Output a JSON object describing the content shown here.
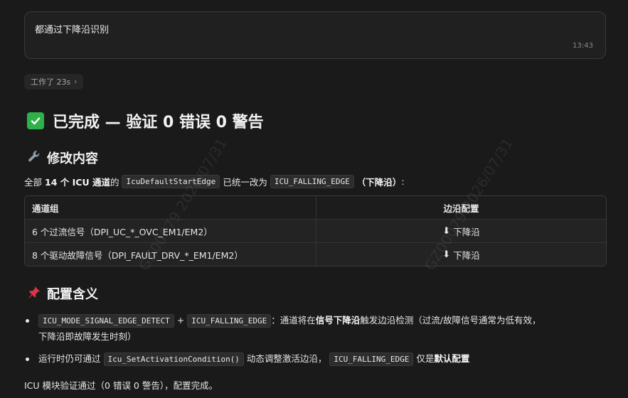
{
  "user_message": {
    "text": "都通过下降沿识别",
    "time": "13:43"
  },
  "worked": {
    "label": "工作了 23s",
    "chevron": "›"
  },
  "heading": {
    "icon": "white-check-mark-icon",
    "text": "已完成 — 验证 0 错误 0 警告"
  },
  "section_changes": {
    "icon": "wrench-icon",
    "title": "修改内容",
    "summary": {
      "prefix": "全部",
      "count": "14 个 ICU 通道",
      "of": "的",
      "param": "IcuDefaultStartEdge",
      "mid": "已统一改为",
      "value": "ICU_FALLING_EDGE",
      "note": "（下降沿）",
      "suffix": ":"
    },
    "table": {
      "headers": [
        "通道组",
        "边沿配置"
      ],
      "rows": [
        {
          "group": "6 个过流信号（DPI_UC_*_OVC_EM1/EM2）",
          "edge": "下降沿"
        },
        {
          "group": "8 个驱动故障信号（DPI_FAULT_DRV_*_EM1/EM2）",
          "edge": "下降沿"
        }
      ]
    }
  },
  "section_meaning": {
    "icon": "pushpin-icon",
    "title": "配置含义",
    "bullets": [
      {
        "code1": "ICU_MODE_SIGNAL_EDGE_DETECT",
        "plus": "+",
        "code2": "ICU_FALLING_EDGE",
        "t1": "：通道将在",
        "bold1": "信号下降沿",
        "t2": "触发边沿检测（过流/故障信号通常为低有效，",
        "t3": "下降沿即故障发生时刻）"
      },
      {
        "t1": "运行时仍可通过",
        "code1": "Icu_SetActivationCondition()",
        "t2": "动态调整激活边沿，",
        "code2": "ICU_FALLING_EDGE",
        "t3": "仅是",
        "bold1": "默认配置"
      }
    ]
  },
  "footer": {
    "text": "ICU 模块验证通过（0 错误 0 警告），配置完成。"
  },
  "watermarks": [
    "GZ00079 2026/07/31",
    "GZ00079 2026/07/31"
  ],
  "colors": {
    "background": "#1a1a1a",
    "check_green": "#2fb14a",
    "code_bg": "#2d2d2d"
  }
}
